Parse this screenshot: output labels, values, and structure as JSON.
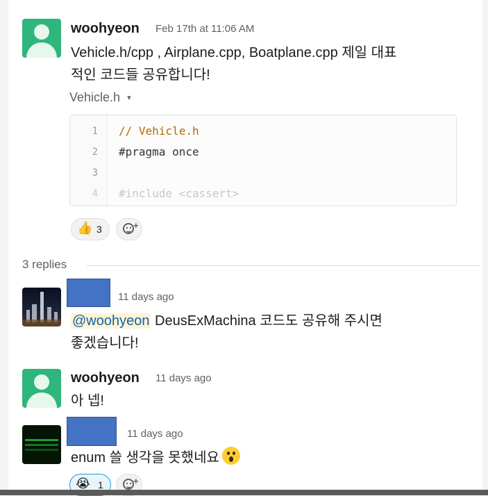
{
  "parent": {
    "author": "woohyeon",
    "timestamp": "Feb 17th at 11:06 AM",
    "text_line1": "Vehicle.h/cpp , Airplane.cpp, Boatplane.cpp 제일 대표",
    "text_line2": "적인 코드들 공유합니다!",
    "attachment": {
      "filename": "Vehicle.h",
      "caret": "▾",
      "lines": [
        {
          "num": "1",
          "text": "// Vehicle.h"
        },
        {
          "num": "2",
          "text": "#pragma once"
        },
        {
          "num": "3",
          "text": ""
        },
        {
          "num": "4",
          "text": "#include <cassert>"
        }
      ]
    },
    "reactions": [
      {
        "icon": "thumbs-up-icon",
        "glyph": "👍",
        "count": "3"
      }
    ],
    "add_reaction_glyph": "+"
  },
  "replies_label": "3 replies",
  "replies": [
    {
      "timestamp": "11 days ago",
      "mention": "@woohyeon",
      "text_line1": " DeusExMachina 코드도 공유해 주시면",
      "text_line2": "좋겠습니다!"
    },
    {
      "author": "woohyeon",
      "timestamp": "11 days ago",
      "text": "아 넵!"
    },
    {
      "timestamp": "11 days ago",
      "text": "enum 쓸 생각을 못했네요",
      "reactions": [
        {
          "icon": "crying-face-icon",
          "glyph": "😭",
          "count": "1"
        }
      ],
      "add_reaction_glyph": "+"
    }
  ],
  "colors": {
    "avatar_green": "#2eb67d",
    "redacted_blue": "#4472c4",
    "mention_bg": "#fdf3d6",
    "mention_text": "#1264a3"
  }
}
